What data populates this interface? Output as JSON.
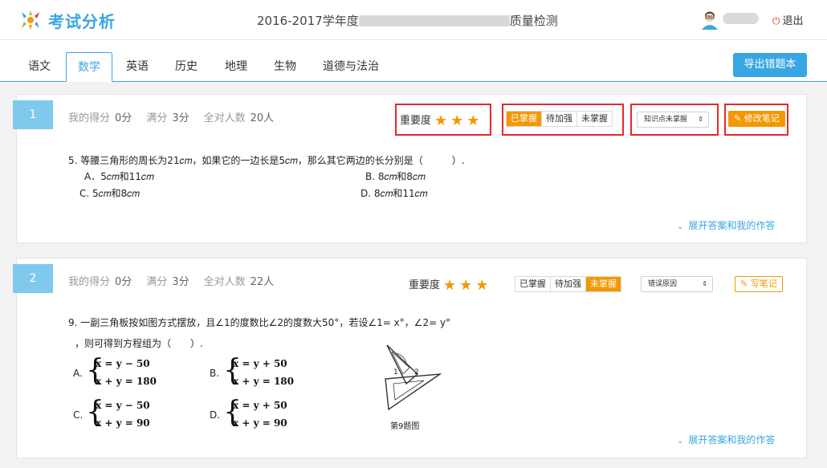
{
  "header": {
    "logo_text": "考试分析",
    "exam_title_prefix": "2016-2017学年度",
    "exam_title_suffix": "质量检测",
    "logout_label": "退出"
  },
  "tabs": [
    {
      "label": "语文"
    },
    {
      "label": "数学",
      "active": true
    },
    {
      "label": "英语"
    },
    {
      "label": "历史"
    },
    {
      "label": "地理"
    },
    {
      "label": "生物"
    },
    {
      "label": "道德与法治"
    }
  ],
  "export_label": "导出错题本",
  "labels": {
    "my_score": "我的得分",
    "full_score": "满分",
    "total_people": "全对人数",
    "importance": "重要度",
    "mastery": [
      "已掌握",
      "待加强",
      "未掌握"
    ],
    "expand": "展开答案和我的作答"
  },
  "questions": [
    {
      "number": "1",
      "my_score": "0分",
      "full_score": "3分",
      "total_people": "20人",
      "stars": 3,
      "selected_mastery": "已掌握",
      "select_value": "知识点未掌握",
      "note_label": "修改笔记",
      "text": "5. 等腰三角形的周长为21𝑐𝑚，如果它的一边长是5𝑐𝑚，那么其它两边的长分别是（　　　）.",
      "options": {
        "A": "A．5𝑐𝑚和11𝑐𝑚",
        "B": "B.  8𝑐𝑚和8𝑐𝑚",
        "C": "C.  5𝑐𝑚和8𝑐𝑚",
        "D": "D. 8𝑐𝑚和11𝑐𝑚"
      }
    },
    {
      "number": "2",
      "my_score": "0分",
      "full_score": "3分",
      "total_people": "22人",
      "stars": 3,
      "selected_mastery": "未掌握",
      "select_value": "错误原因",
      "note_label": "写笔记",
      "text_line1": "9. 一副三角板按如图方式摆放，且∠1的度数比∠2的度数大50°，若设∠1= x°，∠2= y°",
      "text_line2": "，则可得到方程组为（　　）.",
      "options": {
        "A": {
          "label": "A.",
          "eq1": "x = y − 50",
          "eq2": "x + y = 180"
        },
        "B": {
          "label": "B.",
          "eq1": "x = y + 50",
          "eq2": "x + y = 180"
        },
        "C": {
          "label": "C.",
          "eq1": "x = y − 50",
          "eq2": "x + y = 90"
        },
        "D": {
          "label": "D.",
          "eq1": "x = y + 50",
          "eq2": "x + y = 90"
        }
      },
      "figure_labels": [
        "1",
        "2"
      ],
      "figure_caption": "第9题图"
    }
  ],
  "colors": {
    "primary": "#39a6e4",
    "accent": "#f39800",
    "highlight_box": "#e8262b"
  }
}
